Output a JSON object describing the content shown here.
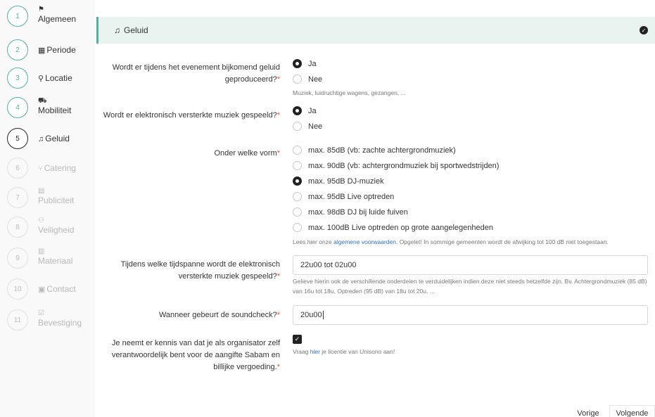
{
  "sidebar": {
    "steps": [
      {
        "number": "1",
        "label": "Algemeen",
        "icon": "flag-icon"
      },
      {
        "number": "2",
        "label": "Periode",
        "icon": "calendar-icon"
      },
      {
        "number": "3",
        "label": "Locatie",
        "icon": "map-pin-icon"
      },
      {
        "number": "4",
        "label": "Mobiliteit",
        "icon": "car-icon"
      },
      {
        "number": "5",
        "label": "Geluid",
        "icon": "music-icon"
      },
      {
        "number": "6",
        "label": "Catering",
        "icon": "cutlery-icon"
      },
      {
        "number": "7",
        "label": "Publiciteit",
        "icon": "newspaper-icon"
      },
      {
        "number": "8",
        "label": "Veiligheid",
        "icon": "people-icon"
      },
      {
        "number": "9",
        "label": "Materiaal",
        "icon": "building-icon"
      },
      {
        "number": "10",
        "label": "Contact",
        "icon": "contact-card-icon"
      },
      {
        "number": "11",
        "label": "Bevestiging",
        "icon": "clipboard-check-icon"
      }
    ]
  },
  "section": {
    "title": "Geluid",
    "icon": "music-icon",
    "status_icon": "check-circle-icon"
  },
  "q1": {
    "label": "Wordt er tijdens het evenement bijkomend geluid geproduceerd?",
    "required": "*",
    "options": [
      "Ja",
      "Nee"
    ],
    "selected": "Ja",
    "help": "Muziek, luidruchtige wagens, gezangen, ..."
  },
  "q2": {
    "label": "Wordt er elektronisch versterkte muziek gespeeld?",
    "required": "*",
    "options": [
      "Ja",
      "Nee"
    ],
    "selected": "Ja"
  },
  "q3": {
    "label": "Onder welke vorm",
    "required": "*",
    "options": [
      "max. 85dB (vb: zachte achtergrondmuziek)",
      "max. 90dB (vb: achtergrondmuziek bij sportwedstrijden)",
      "max. 95dB DJ-muziek",
      "max. 95dB Live optreden",
      "max. 98dB DJ bij luide fuiven",
      "max. 100dB Live optreden op grote aangelegenheden"
    ],
    "selected": "max. 95dB DJ-muziek",
    "help_prefix": "Lees hier onze ",
    "help_link": "algemene voorwaarden",
    "help_suffix": ". Opgelet! In sommige gemeenten wordt de afwijking tot 100 dB niet toegestaan."
  },
  "q4": {
    "label": "Tijdens welke tijdspanne wordt de elektronisch versterkte muziek gespeeld?",
    "required": "*",
    "value": "22u00 tot 02u00",
    "help": "Gelieve hierin ook de verschillende onderdelen te verduidelijken indien deze niet steeds hetzelfde zijn. Bv. Achtergrondmuziek (85 dB) van 16u tot 18u, Optreden (95 dB) van 18u tot 20u, ..."
  },
  "q5": {
    "label": "Wanneer gebeurt de soundcheck?",
    "required": "*",
    "value": "20u00"
  },
  "q6": {
    "label": "Je neemt er kennis van dat je als organisator zelf verantwoordelijk bent voor de aangifte Sabam en billijke vergoeding.",
    "required": "*",
    "checked": true,
    "help_prefix": "Vraag ",
    "help_link": "hier",
    "help_suffix": " je licentie van Unisono aan!"
  },
  "nav": {
    "prev_label": "Vorige",
    "next_label": "Volgende"
  }
}
